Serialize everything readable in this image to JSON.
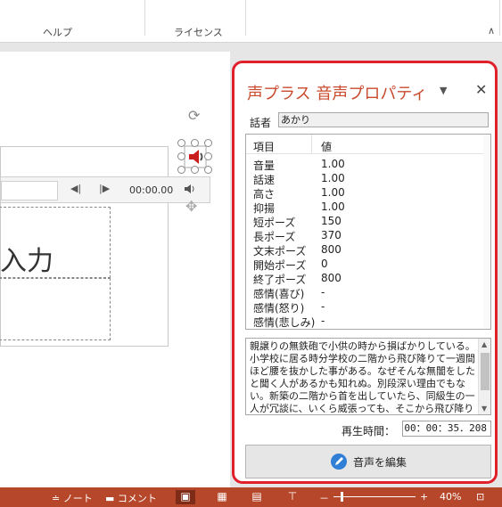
{
  "ribbon": {
    "groups": [
      "ヘルプ",
      "ライセンス"
    ],
    "collapse_glyph": "∧"
  },
  "slide": {
    "text": "入力",
    "player": {
      "time": "00:00.00",
      "prev_glyph": "◀|",
      "next_glyph": "|▶",
      "volume_icon": "speaker-icon"
    }
  },
  "panel": {
    "title": "声プラス 音声プロパティ",
    "dropdown_glyph": "▼",
    "close_glyph": "✕",
    "speaker": {
      "label": "話者",
      "value": "あかり"
    },
    "props": {
      "header": {
        "name": "項目",
        "value": "値"
      },
      "rows": [
        {
          "name": "音量",
          "value": "1.00"
        },
        {
          "name": "話速",
          "value": "1.00"
        },
        {
          "name": "高さ",
          "value": "1.00"
        },
        {
          "name": "抑揚",
          "value": "1.00"
        },
        {
          "name": "短ポーズ",
          "value": "150"
        },
        {
          "name": "長ポーズ",
          "value": "370"
        },
        {
          "name": "文末ポーズ",
          "value": "800"
        },
        {
          "name": "開始ポーズ",
          "value": "0"
        },
        {
          "name": "終了ポーズ",
          "value": "800"
        },
        {
          "name": "感情(喜び)",
          "value": "-"
        },
        {
          "name": "感情(怒り)",
          "value": "-"
        },
        {
          "name": "感情(悲しみ)",
          "value": "-"
        }
      ]
    },
    "text": "親譲りの無鉄砲で小供の時から損ばかりしている。小学校に居る時分学校の二階から飛び降りて一週間ほど腰を抜かした事がある。なぜそんな無闇をしたと聞く人があるかも知れぬ。別段深い理由でもない。新築の二階から首を出していたら、同級生の一人が冗談に、いくら威張っても、そこから飛び降りる事は出来まい。弱虫やーい。と囃したからである。",
    "playtime": {
      "label": "再生時間：",
      "value": "00：00：35．208"
    },
    "edit_button": "音声を編集",
    "accent": "#e0202a"
  },
  "status": {
    "notes": "ノート",
    "comments": "コメント",
    "zoom_minus": "－",
    "zoom_plus": "+",
    "zoom": "40%"
  },
  "colors": {
    "status_bar": "#b7472a",
    "panel_border": "#e0202a",
    "title": "#c94a2c"
  }
}
